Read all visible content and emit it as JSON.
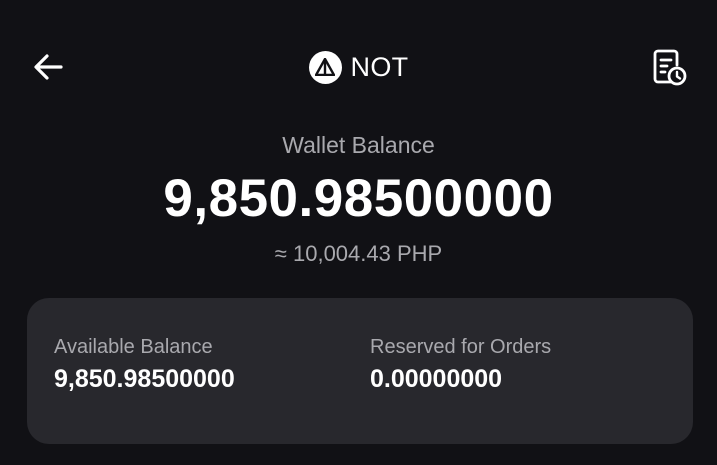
{
  "header": {
    "coin_name": "NOT",
    "back_icon": "arrow-left-icon",
    "history_icon": "receipt-clock-icon",
    "coin_logo_icon": "not-coin-logo-icon"
  },
  "wallet": {
    "label": "Wallet Balance",
    "amount": "9,850.98500000",
    "fiat_equivalent": "≈ 10,004.43 PHP"
  },
  "details": {
    "available_label": "Available Balance",
    "available_value": "9,850.98500000",
    "reserved_label": "Reserved for Orders",
    "reserved_value": "0.00000000"
  },
  "colors": {
    "background": "#111115",
    "card": "#28282d",
    "text_primary": "#ffffff",
    "text_secondary": "#a9a9ae"
  }
}
